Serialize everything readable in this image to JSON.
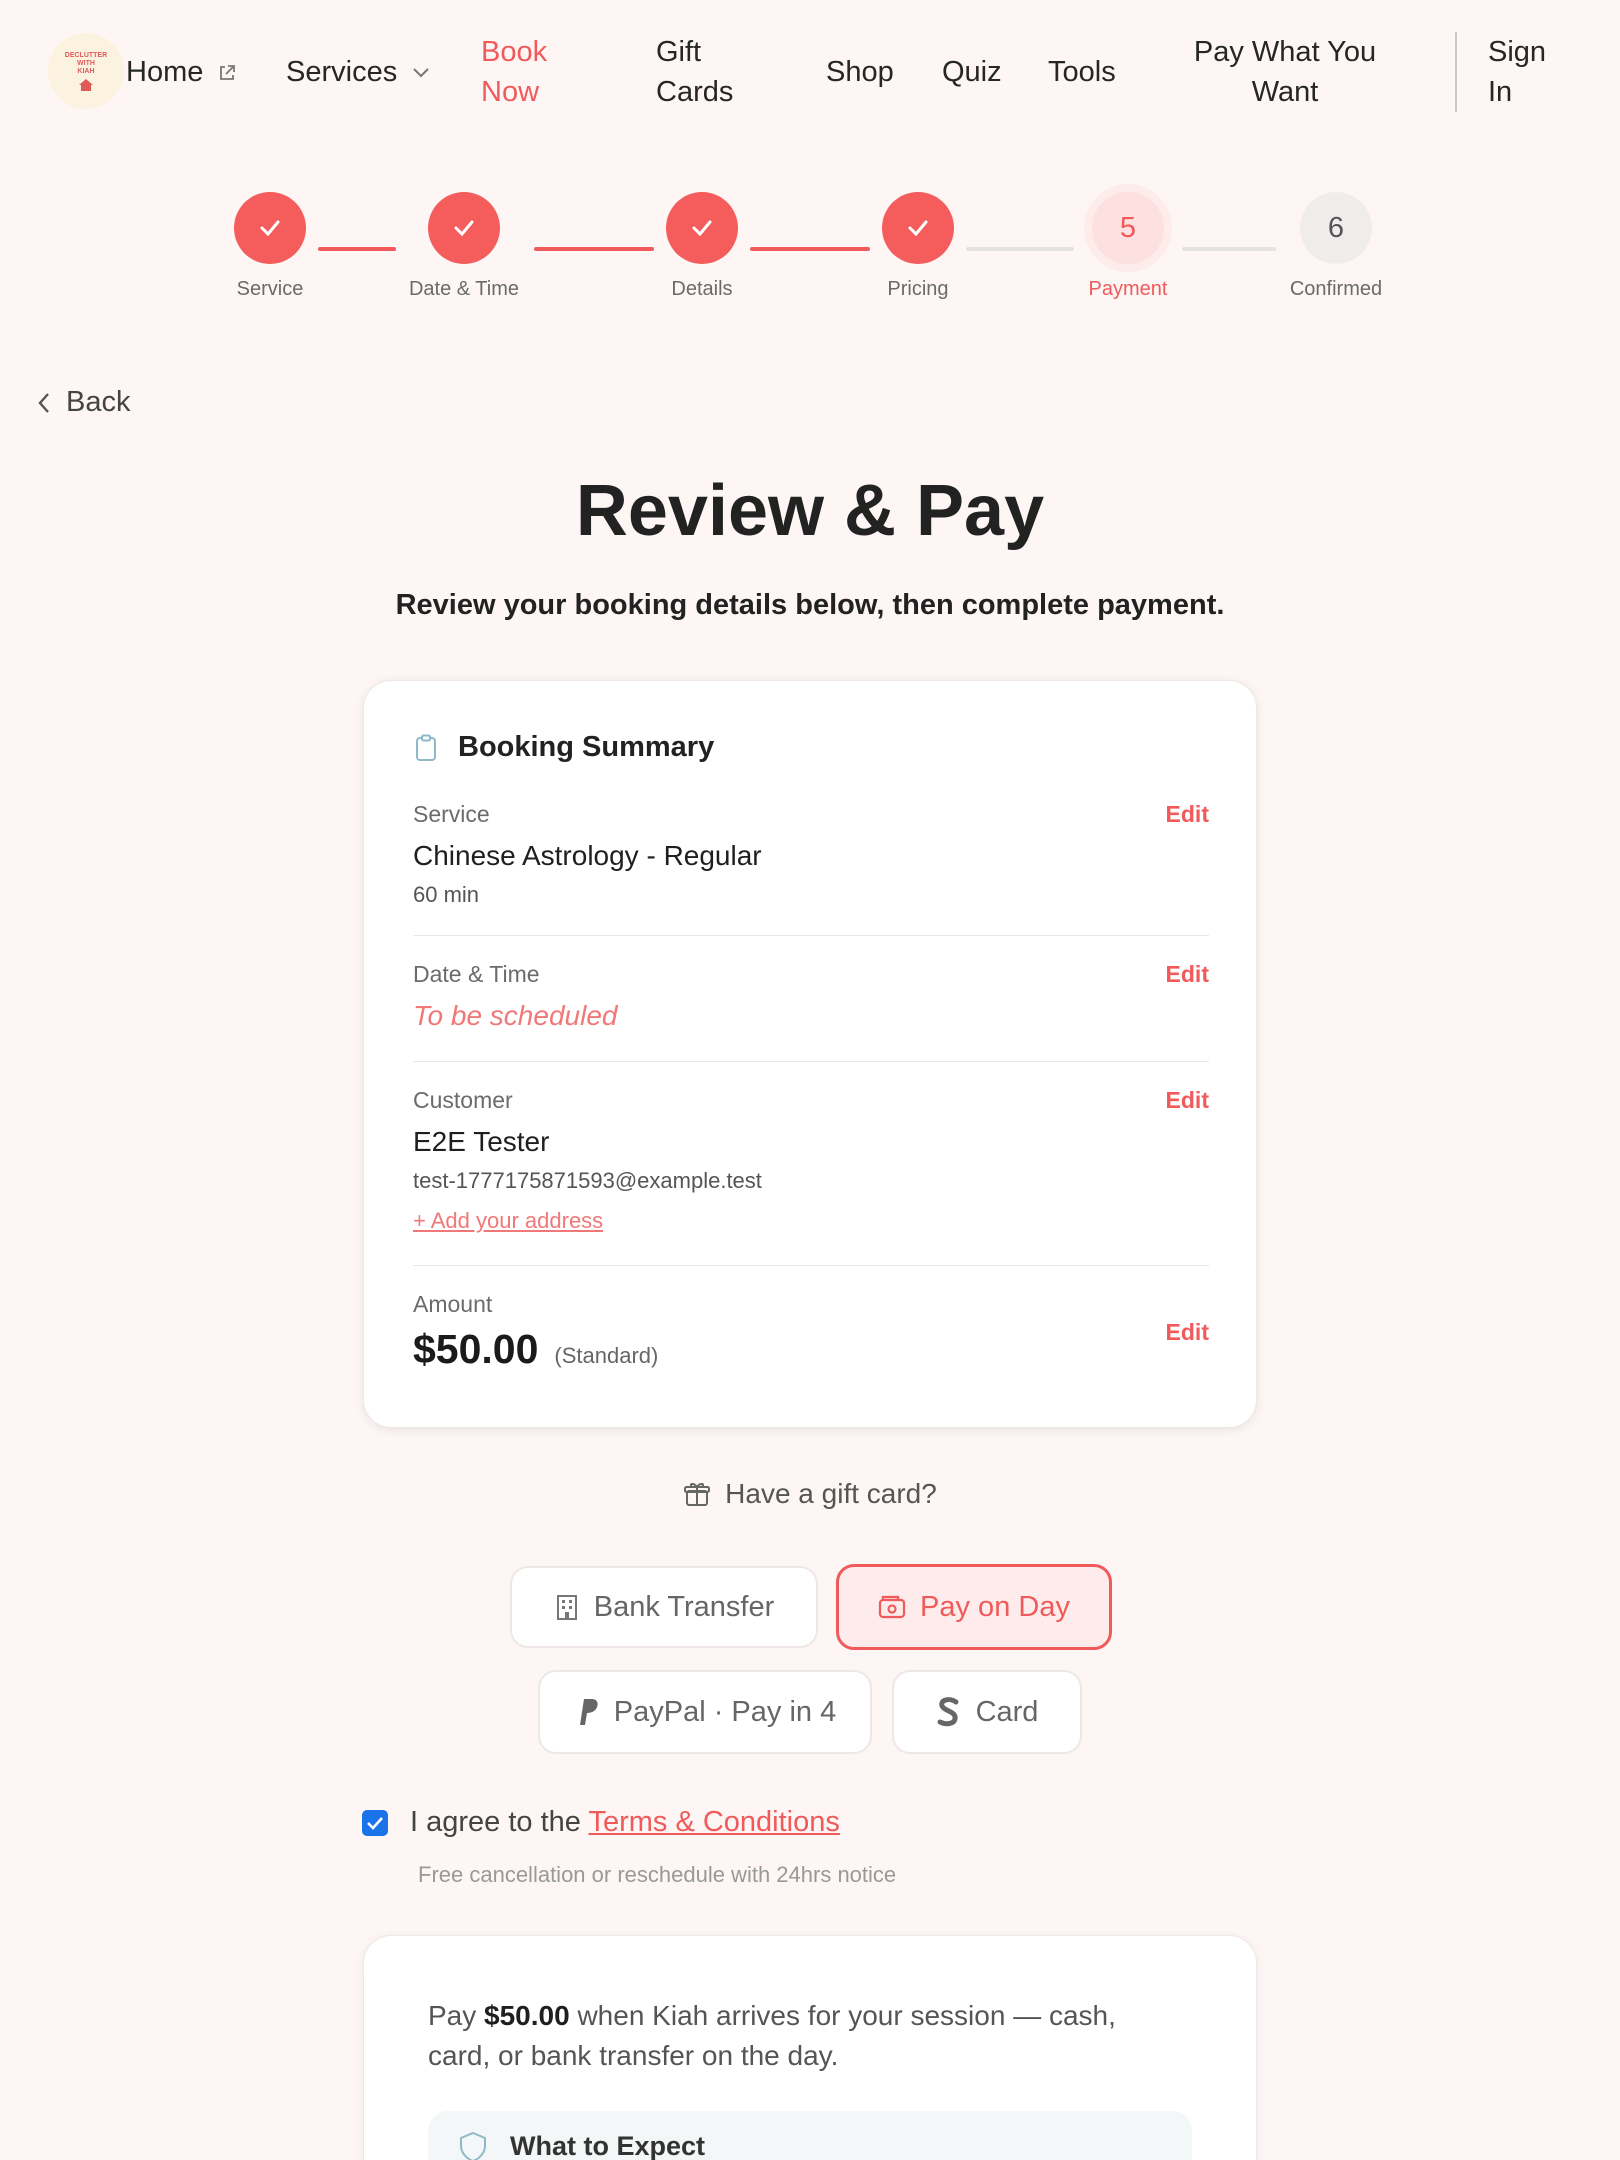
{
  "nav": {
    "logo_text": "DECLUTTER WITH KIAH",
    "home": "Home",
    "services": "Services",
    "book_now": "Book Now",
    "gift_cards": "Gift Cards",
    "shop": "Shop",
    "quiz": "Quiz",
    "tools": "Tools",
    "pay_what_you_want": "Pay What You Want",
    "sign_in": "Sign In"
  },
  "stepper": {
    "steps": [
      {
        "label": "Service",
        "state": "done"
      },
      {
        "label": "Date & Time",
        "state": "done"
      },
      {
        "label": "Details",
        "state": "done"
      },
      {
        "label": "Pricing",
        "state": "done"
      },
      {
        "label": "Payment",
        "number": "5",
        "state": "current"
      },
      {
        "label": "Confirmed",
        "number": "6",
        "state": "future"
      }
    ]
  },
  "back_label": "Back",
  "page": {
    "title": "Review & Pay",
    "subtitle": "Review your booking details below, then complete payment."
  },
  "summary": {
    "title": "Booking Summary",
    "edit_label": "Edit",
    "service": {
      "label": "Service",
      "name": "Chinese Astrology - Regular",
      "duration": "60 min"
    },
    "datetime": {
      "label": "Date & Time",
      "value": "To be scheduled"
    },
    "customer": {
      "label": "Customer",
      "name": "E2E Tester",
      "email": "test-1777175871593@example.test",
      "add_address": "+ Add your address"
    },
    "amount": {
      "label": "Amount",
      "value": "$50.00",
      "tier": "(Standard)"
    }
  },
  "gift_card_prompt": "Have a gift card?",
  "payment_methods": {
    "bank_transfer": "Bank Transfer",
    "pay_on_day": "Pay on Day",
    "paypal": "PayPal · Pay in 4",
    "card": "Card",
    "selected": "Pay on Day"
  },
  "terms": {
    "prefix": "I agree to the",
    "link": "Terms & Conditions",
    "note": "Free cancellation or reschedule with 24hrs notice",
    "checked": true
  },
  "pay_on_day_info": {
    "prefix": "Pay",
    "amount": "$50.00",
    "suffix": "when Kiah arrives for your session — cash, card, or bank transfer on the day.",
    "expect_title": "What to Expect"
  },
  "colors": {
    "accent": "#f05a5a",
    "accent_light": "#fdeceb",
    "background": "#fdf6f5",
    "checkbox": "#1a73e8"
  }
}
